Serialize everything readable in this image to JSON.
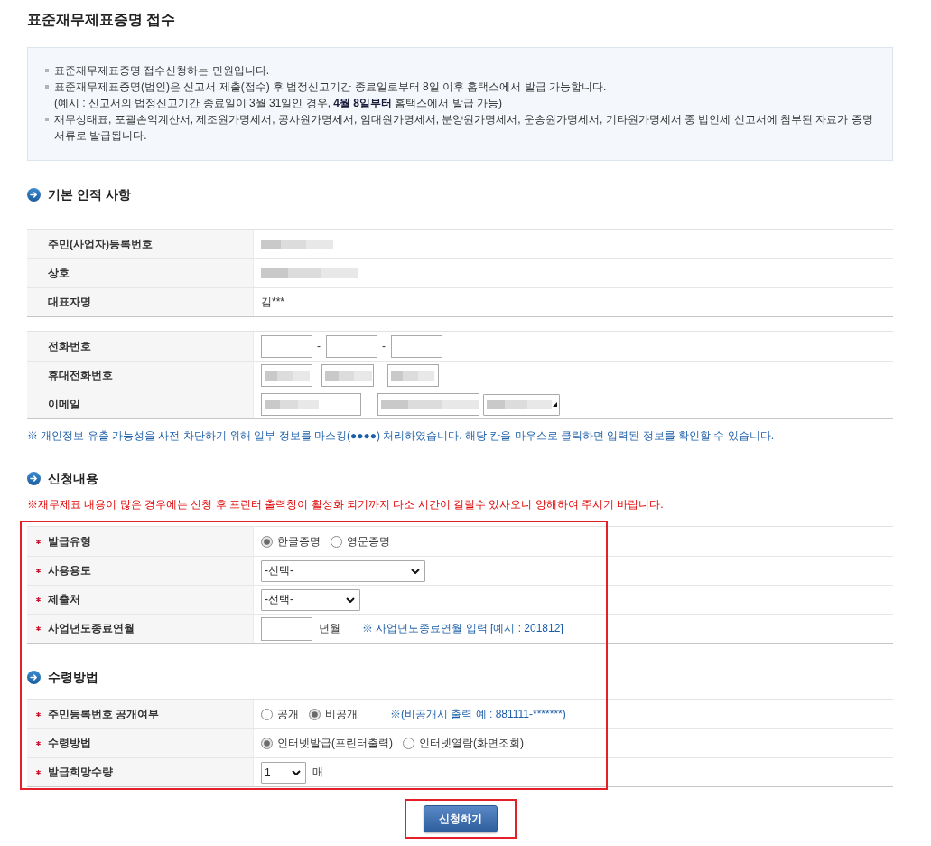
{
  "page_title": "표준재무제표증명 접수",
  "notice": {
    "items": [
      {
        "lines": [
          "표준재무제표증명 접수신청하는 민원입니다."
        ]
      },
      {
        "lines": [
          "표준재무제표증명(법인)은 신고서 제출(접수) 후 법정신고기간 종료일로부터 8일 이후 홈택스에서 발급 가능합니다.",
          "(예시 : 신고서의 법정신고기간 종료일이 3월 31일인 경우, **4월 8일부터** 홈택스에서 발급 가능)"
        ]
      },
      {
        "lines": [
          "재무상태표, 포괄손익계산서, 제조원가명세서, 공사원가명세서, 임대원가명세서, 분양원가명세서, 운송원가명세서, 기타원가명세서 중 법인세 신고서에 첨부된 자료가 증명 서류로 발급됩니다."
        ]
      }
    ]
  },
  "basic_info": {
    "title": "기본 인적 사항",
    "rows": [
      {
        "label": "주민(사업자)등록번호",
        "kind": "masked"
      },
      {
        "label": "상호",
        "kind": "masked"
      },
      {
        "label": "대표자명",
        "kind": "text",
        "value": "김***"
      }
    ]
  },
  "contact": {
    "rows": [
      {
        "label": "전화번호",
        "parts": [
          {
            "kind": "input",
            "masked": false
          },
          {
            "kind": "separator",
            "text": "-"
          },
          {
            "kind": "input",
            "masked": false
          },
          {
            "kind": "separator",
            "text": "-"
          },
          {
            "kind": "input",
            "masked": false
          }
        ]
      },
      {
        "label": "휴대전화번호",
        "parts": [
          {
            "kind": "input",
            "masked": true
          },
          {
            "kind": "input",
            "masked": true
          },
          {
            "kind": "input",
            "masked": true
          }
        ]
      },
      {
        "label": "이메일",
        "parts": [
          {
            "kind": "input",
            "masked": true
          },
          {
            "kind": "input",
            "masked": true
          },
          {
            "kind": "select",
            "masked": true
          }
        ]
      }
    ]
  },
  "privacy_note": "※ 개인정보 유출 가능성을 사전 차단하기 위해 일부 정보를 마스킹(●●●●) 처리하였습니다. 해당 칸을 마우스로 클릭하면 입력된 정보를 확인할 수 있습니다.",
  "application": {
    "title": "신청내용",
    "warning": "※재무제표 내용이 많은 경우에는 신청 후 프린터 출력창이 활성화 되기까지 다소 시간이 걸릴수 있사오니 양해하여 주시기 바랍니다.",
    "highlighted": true,
    "rows": [
      {
        "label": "발급유형",
        "required": true,
        "kind": "radio",
        "options": [
          {
            "label": "한글증명",
            "selected": true
          },
          {
            "label": "영문증명",
            "selected": false
          }
        ]
      },
      {
        "label": "사용용도",
        "required": true,
        "kind": "select",
        "value": "-선택-"
      },
      {
        "label": "제출처",
        "required": true,
        "kind": "select",
        "value": "-선택-"
      },
      {
        "label": "사업년도종료연월",
        "required": true,
        "kind": "input",
        "unit": "년월",
        "note": "※ 사업년도종료연월 입력 [예시 : 201812]"
      }
    ]
  },
  "receipt": {
    "title": "수령방법",
    "rows": [
      {
        "label": "주민등록번호 공개여부",
        "required": true,
        "kind": "radio",
        "options": [
          {
            "label": "공개",
            "selected": false
          },
          {
            "label": "비공개",
            "selected": true
          }
        ],
        "note": "※(비공개시 출력 예 : 881111-*******)"
      },
      {
        "label": "수령방법",
        "required": true,
        "kind": "radio",
        "options": [
          {
            "label": "인터넷발급(프린터출력)",
            "selected": true
          },
          {
            "label": "인터넷열람(화면조회)",
            "selected": false
          }
        ]
      },
      {
        "label": "발급희망수량",
        "required": true,
        "kind": "select",
        "value": "1",
        "unit": "매"
      }
    ]
  },
  "submit": {
    "label": "신청하기",
    "highlighted": true
  }
}
